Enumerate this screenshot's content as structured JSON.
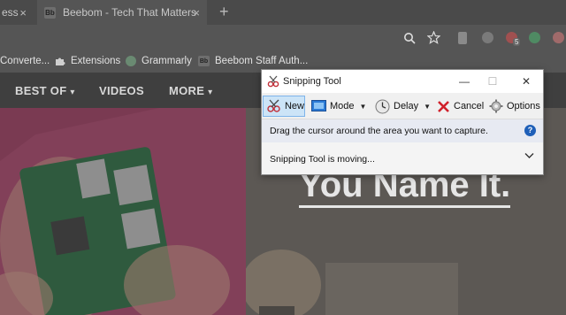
{
  "browser": {
    "tabs": [
      {
        "title": "ess",
        "active": false
      },
      {
        "title": "Beebom - Tech That Matters",
        "favicon": "Bb",
        "active": true
      }
    ],
    "new_tab_symbol": "+",
    "close_symbol": "×",
    "toolbar_icons": [
      "zoom-icon",
      "star-icon",
      "extension-icon",
      "extension-icon",
      "extension-badge-icon",
      "grammarly-icon",
      "extension-icon"
    ],
    "extension_badge": "5",
    "bookmarks": [
      {
        "label": "Converte...",
        "icon": "none"
      },
      {
        "label": "Extensions",
        "icon": "puzzle-icon"
      },
      {
        "label": "Grammarly",
        "icon": "grammarly-icon"
      },
      {
        "label": "Beebom Staff Auth...",
        "icon": "beebom-icon",
        "favicon": "Bb"
      }
    ]
  },
  "site": {
    "nav": [
      {
        "label": "BEST OF",
        "caret": "▾"
      },
      {
        "label": "VIDEOS"
      },
      {
        "label": "MORE",
        "caret": "▾"
      }
    ],
    "hero_title": "You Name It."
  },
  "snipping_tool": {
    "title": "Snipping Tool",
    "window_buttons": {
      "minimize": "—",
      "maximize": "☐",
      "close": "✕"
    },
    "tools": [
      {
        "label": "New",
        "underline": "N",
        "selected": true
      },
      {
        "label": "Mode",
        "underline": "M",
        "dropdown": true
      },
      {
        "label": "Delay",
        "underline": "D",
        "dropdown": true
      },
      {
        "label": "Cancel",
        "underline": "C"
      },
      {
        "label": "Options",
        "underline": "O"
      }
    ],
    "message": "Drag the cursor around the area you want to capture.",
    "help_symbol": "?",
    "status": "Snipping Tool is moving...",
    "status_chevron": "⌄"
  },
  "colors": {
    "hero_left": "#7a3a52",
    "snip_selected": "#cce4f7",
    "message_bar": "#e7eaf2",
    "help": "#1e5fb8",
    "cancel_red": "#d0202a"
  }
}
